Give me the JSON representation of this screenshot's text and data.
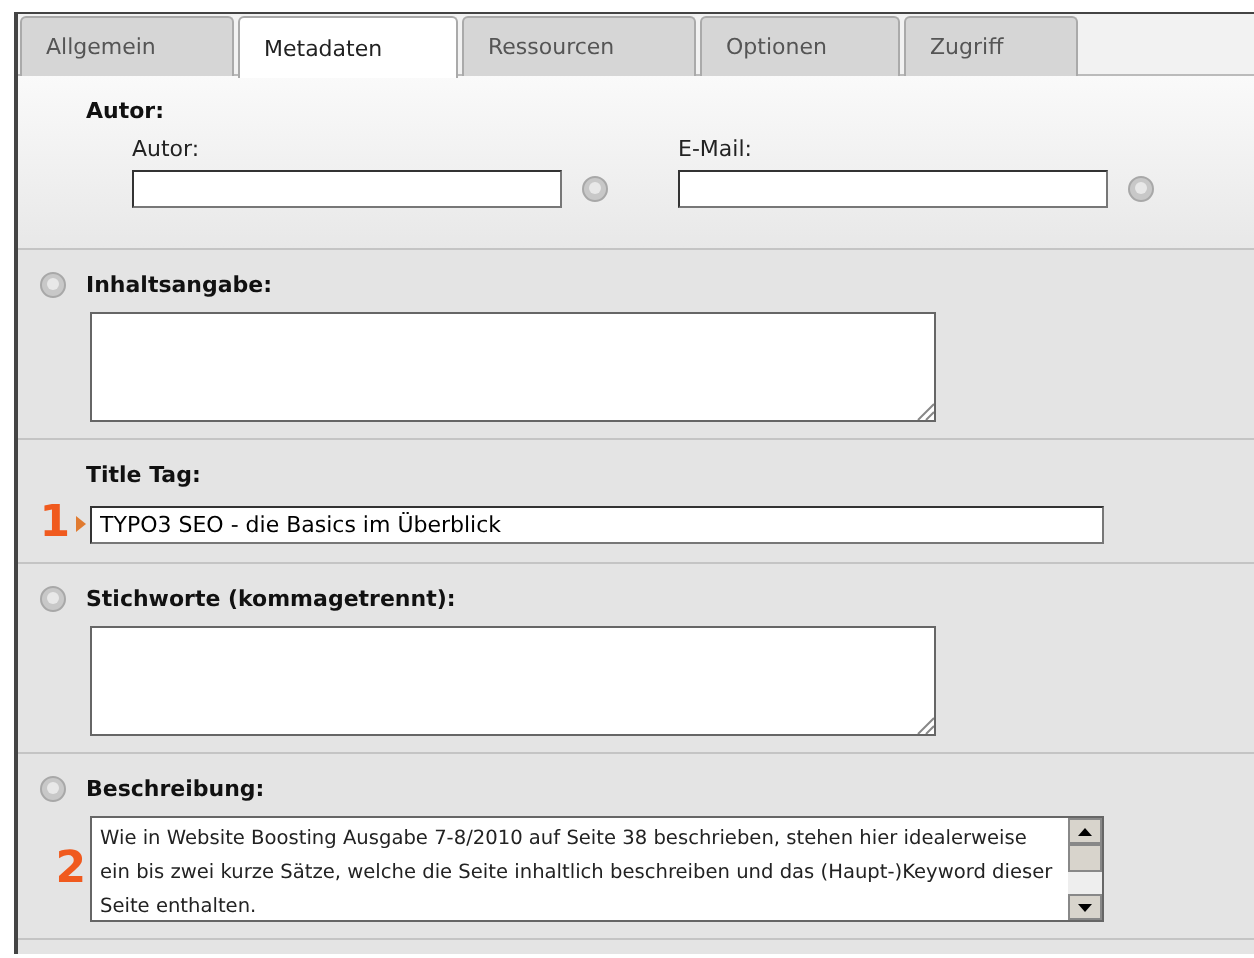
{
  "tabs": [
    {
      "label": "Allgemein",
      "selected": false
    },
    {
      "label": "Metadaten",
      "selected": true
    },
    {
      "label": "Ressourcen",
      "selected": false
    },
    {
      "label": "Optionen",
      "selected": false
    },
    {
      "label": "Zugriff",
      "selected": false
    }
  ],
  "sections": [
    {
      "kind": "group",
      "title": "Autor:",
      "help": false,
      "fields": [
        {
          "label": "Autor:"
        },
        {
          "label": "E-Mail:"
        }
      ]
    },
    {
      "kind": "textarea",
      "title": "Inhaltsangabe:",
      "help": true
    },
    {
      "kind": "input",
      "title": "Title Tag:",
      "help": false,
      "marker": "1",
      "value": "TYPO3 SEO - die Basics im Überblick"
    },
    {
      "kind": "textarea",
      "title": "Stichworte (kommagetrennt):",
      "help": true
    },
    {
      "kind": "scrolltext",
      "title": "Beschreibung:",
      "help": true,
      "marker": "2",
      "value": "Wie in Website Boosting Ausgabe 7-8/2010 auf Seite 38 beschrieben, stehen hier idealerweise ein bis zwei kurze Sätze, welche die Seite inhaltlich beschreiben und das (Haupt-)Keyword dieser Seite enthalten."
    }
  ]
}
